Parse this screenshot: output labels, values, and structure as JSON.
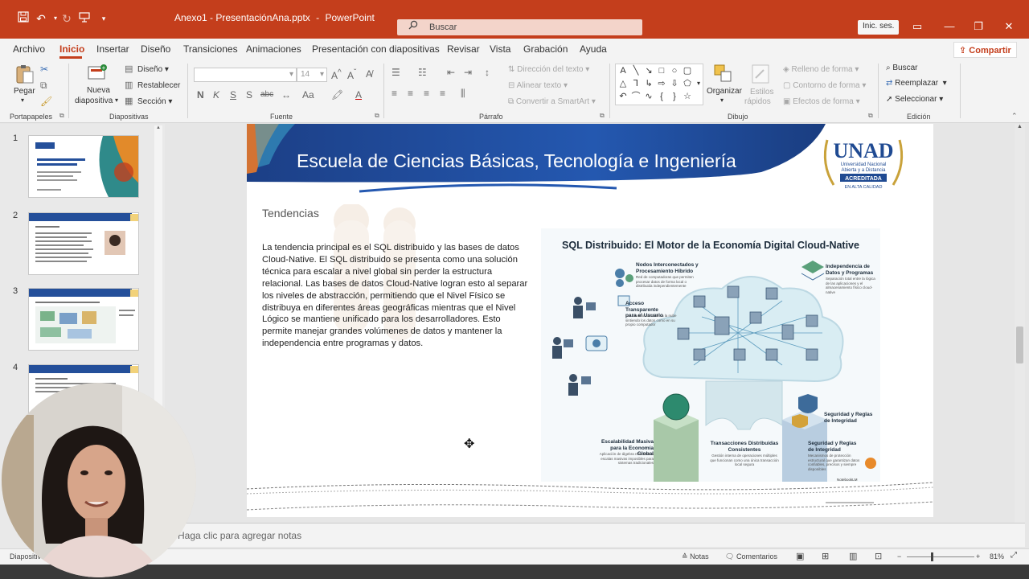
{
  "window": {
    "title": "Anexo1 - PresentaciónAna.pptx",
    "app_name": "PowerPoint",
    "search_placeholder": "Buscar",
    "signin_label": "Inic. ses."
  },
  "menu": {
    "tabs": [
      "Archivo",
      "Inicio",
      "Insertar",
      "Diseño",
      "Transiciones",
      "Animaciones",
      "Presentación con diapositivas",
      "Revisar",
      "Vista",
      "Grabación",
      "Ayuda"
    ],
    "active_tab": "Inicio",
    "share_label": "Compartir"
  },
  "ribbon": {
    "clipboard": {
      "paste": "Pegar",
      "group_label": "Portapapeles"
    },
    "slides": {
      "new_slide_line1": "Nueva",
      "new_slide_line2": "diapositiva",
      "layout": "Diseño",
      "reset": "Restablecer",
      "section": "Sección",
      "group_label": "Diapositivas"
    },
    "font": {
      "font_size": "14",
      "bold": "N",
      "italic": "K",
      "underline": "S",
      "shadow": "S",
      "strike": "abc",
      "group_label": "Fuente"
    },
    "paragraph": {
      "text_direction": "Dirección del texto",
      "align_text": "Alinear texto",
      "smartart": "Convertir a SmartArt",
      "group_label": "Párrafo"
    },
    "drawing": {
      "arrange": "Organizar",
      "styles_line1": "Estilos",
      "styles_line2": "rápidos",
      "fill": "Relleno de forma",
      "outline": "Contorno de forma",
      "effects": "Efectos de forma",
      "group_label": "Dibujo"
    },
    "editing": {
      "find": "Buscar",
      "replace": "Reemplazar",
      "select": "Seleccionar",
      "group_label": "Edición"
    }
  },
  "thumbnails": {
    "numbers": [
      "1",
      "2",
      "3",
      "4"
    ]
  },
  "slide": {
    "title": "Escuela de Ciencias Básicas, Tecnología e Ingeniería",
    "subtitle": "Tendencias",
    "body": "La tendencia principal es el SQL distribuido y las bases de datos Cloud-Native. El SQL distribuido se presenta como una solución técnica para escalar a nivel global sin perder la estructura relacional. Las bases de datos Cloud-Native logran esto al separar los niveles de abstracción, permitiendo que el Nivel Físico se distribuya en diferentes áreas geográficas mientras que el Nivel Lógico se mantiene unificado para los desarrolladores. Esto permite manejar grandes volúmenes de datos y mantener la independencia entre programas y datos.",
    "logo": {
      "name": "UNAD",
      "line1": "Universidad Nacional",
      "line2": "Abierta y a Distancia",
      "badge1": "ACREDITADA",
      "badge2": "EN ALTA CALIDAD"
    },
    "infographic": {
      "title": "SQL Distribuido: El Motor de la Economía Digital Cloud-Native",
      "labels": {
        "nodes": "Nodos Interconectados y Procesamiento Híbrido",
        "nodes_desc": "Red de computadoras que permiten procesar datos de forma local o distribuida independientemente",
        "access": "Acceso Transparente para el Usuario",
        "access_desc": "Los usuarios acceden a la nube sintiendo los datos como en su propio computador",
        "independence": "Independencia de Datos y Programas",
        "independence_desc": "Separación total entre la lógica de las aplicaciones y el almacenamiento físico cloud-native",
        "security_top": "Seguridad y Reglas de Integridad",
        "scalability": "Escalabilidad Masiva para la Economía Global",
        "scalability_desc": "Aplicación de álgebra relacional a escalas masivas imposibles para sistemas tradicionales",
        "transactions": "Transacciones Distribuidas Consistentes",
        "transactions_desc": "Gestión interna de operaciones múltiples que funcionan como una única transacción local segura",
        "security_bottom": "Seguridad y Reglas de Integridad",
        "security_desc": "Mecanismos de protección estructural que garantizan datos confiables, precisos y siempre disponibles",
        "notebook": "NotebookLM"
      }
    }
  },
  "notes": {
    "placeholder": "Haga clic para agregar notas"
  },
  "status": {
    "slide_info": "Diapositiva",
    "notes_label": "Notas",
    "comments_label": "Comentarios",
    "zoom": "81%"
  },
  "colors": {
    "accent": "#c43e1c",
    "slide_header_blue": "#1e4b93",
    "thumb_header_blue": "#244f9a"
  }
}
